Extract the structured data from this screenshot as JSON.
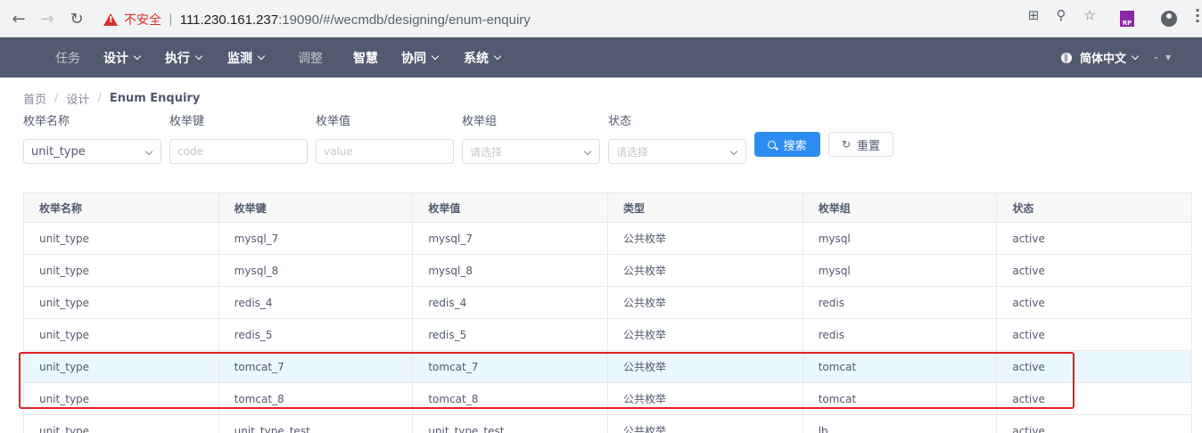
{
  "browser": {
    "insecure_label": "不安全",
    "url_host": "111.230.161.237",
    "url_rest": ":19090/#/wecmdb/designing/enum-enquiry"
  },
  "header": {
    "nav": [
      {
        "label": "任务",
        "dropdown": false,
        "dim": true
      },
      {
        "label": "设计",
        "dropdown": true,
        "dim": false
      },
      {
        "label": "执行",
        "dropdown": true,
        "dim": false
      },
      {
        "label": "监测",
        "dropdown": true,
        "dim": false
      },
      {
        "label": "调整",
        "dropdown": false,
        "dim": true
      },
      {
        "label": "智慧",
        "dropdown": false,
        "dim": false
      },
      {
        "label": "协同",
        "dropdown": true,
        "dim": false
      },
      {
        "label": "系统",
        "dropdown": true,
        "dim": false
      }
    ],
    "language": "简体中文",
    "user": "-"
  },
  "breadcrumb": [
    "首页",
    "设计",
    "Enum Enquiry"
  ],
  "filters": {
    "labels": [
      "枚举名称",
      "枚举键",
      "枚举值",
      "枚举组",
      "状态"
    ],
    "enum_name_value": "unit_type",
    "code_placeholder": "code",
    "value_placeholder": "value",
    "group_placeholder": "请选择",
    "status_placeholder": "请选择",
    "search_label": "搜索",
    "reset_label": "重置"
  },
  "table": {
    "columns": [
      "枚举名称",
      "枚举键",
      "枚举值",
      "类型",
      "枚举组",
      "状态"
    ],
    "rows": [
      [
        "unit_type",
        "mysql_7",
        "mysql_7",
        "公共枚举",
        "mysql",
        "active"
      ],
      [
        "unit_type",
        "mysql_8",
        "mysql_8",
        "公共枚举",
        "mysql",
        "active"
      ],
      [
        "unit_type",
        "redis_4",
        "redis_4",
        "公共枚举",
        "redis",
        "active"
      ],
      [
        "unit_type",
        "redis_5",
        "redis_5",
        "公共枚举",
        "redis",
        "active"
      ],
      [
        "unit_type",
        "tomcat_7",
        "tomcat_7",
        "公共枚举",
        "tomcat",
        "active"
      ],
      [
        "unit_type",
        "tomcat_8",
        "tomcat_8",
        "公共枚举",
        "tomcat",
        "active"
      ],
      [
        "unit_type",
        "unit_type_test",
        "unit_type_test",
        "公共枚举",
        "lb",
        "active"
      ]
    ],
    "highlighted_row": 4
  },
  "colors": {
    "header_bg": "#515a6e",
    "primary": "#2d8cf0",
    "annotation": "#e02020"
  }
}
